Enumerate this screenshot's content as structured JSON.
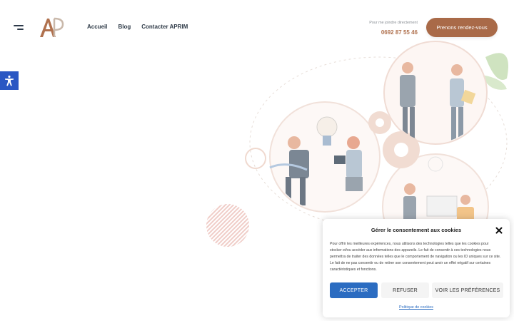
{
  "header": {
    "logo_text": "AP",
    "nav": [
      "Accueil",
      "Blog",
      "Contacter APRIM"
    ],
    "contact_label": "Pour me joindre directement",
    "phone": "0692 87 55 46",
    "cta_label": "Prenons rendez-vous"
  },
  "accessibility": {
    "icon": "accessibility-icon"
  },
  "cookie_banner": {
    "title": "Gérer le consentement aux cookies",
    "text": "Pour offrir les meilleures expériences, nous utilisons des technologies telles que les cookies pour stocker et/ou accéder aux informations des appareils. Le fait de consentir à ces technologies nous permettra de traiter des données telles que le comportement de navigation ou les ID uniques sur ce site. Le fait de ne pas consentir ou de retirer son consentement peut avoir un effet négatif sur certaines caractéristiques et fonctions.",
    "accept_label": "ACCEPTER",
    "refuse_label": "REFUSER",
    "prefs_label": "VOIR LES PRÉFÉRENCES",
    "policy_link": "Politique de cookies"
  },
  "colors": {
    "brand": "#a96a48",
    "accent_blue": "#2b6cc1",
    "a11y_blue": "#2a57c3"
  }
}
